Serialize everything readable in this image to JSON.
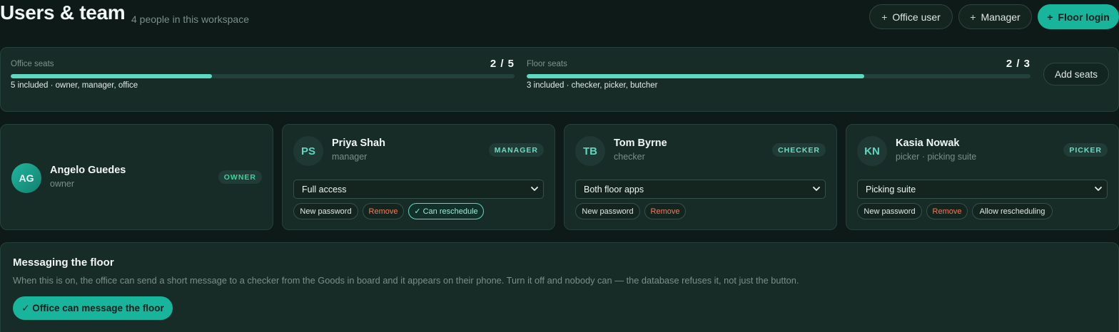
{
  "header": {
    "title": "Users & team",
    "subtitle": "4 people in this workspace",
    "buttons": {
      "office_user": "Office user",
      "manager": "Manager",
      "floor_login": "Floor login"
    },
    "plus_glyph": "+"
  },
  "seats": {
    "office": {
      "label": "Office seats",
      "used": 2,
      "total": 5,
      "count_text": "2 / 5",
      "note": "5 included · owner, manager, office",
      "fill": 0.4
    },
    "floor": {
      "label": "Floor seats",
      "used": 2,
      "total": 3,
      "count_text": "2 / 3",
      "note": "3 included · checker, picker, butcher",
      "fill": 0.67
    },
    "add_button": "Add seats"
  },
  "users": [
    {
      "initials": "AG",
      "name": "Angelo Guedes",
      "role": "owner",
      "badge": "OWNER"
    },
    {
      "initials": "PS",
      "name": "Priya Shah",
      "role": "manager",
      "badge": "MANAGER",
      "access": "Full access",
      "actions": {
        "new_password": "New password",
        "remove": "Remove",
        "reschedule": "✓ Can reschedule"
      }
    },
    {
      "initials": "TB",
      "name": "Tom Byrne",
      "role": "checker",
      "badge": "CHECKER",
      "access": "Both floor apps",
      "actions": {
        "new_password": "New password",
        "remove": "Remove"
      }
    },
    {
      "initials": "KN",
      "name": "Kasia Nowak",
      "role": "picker · picking suite",
      "badge": "PICKER",
      "access": "Picking suite",
      "actions": {
        "new_password": "New password",
        "remove": "Remove",
        "reschedule": "Allow rescheduling"
      }
    }
  ],
  "messaging": {
    "title": "Messaging the floor",
    "description": "When this is on, the office can send a short message to a checker from the Goods in board and it appears on their phone. Turn it off and nobody can — the database refuses it, not just the button.",
    "toggle_label": "✓ Office can message the floor"
  },
  "colors": {
    "accent": "#19b49c",
    "bar": "#5ed8c0",
    "remove": "#f27b5f",
    "background": "#0d1a17",
    "card": "#182c27"
  },
  "icons": {
    "select_chevron": "chevron-down-icon"
  }
}
